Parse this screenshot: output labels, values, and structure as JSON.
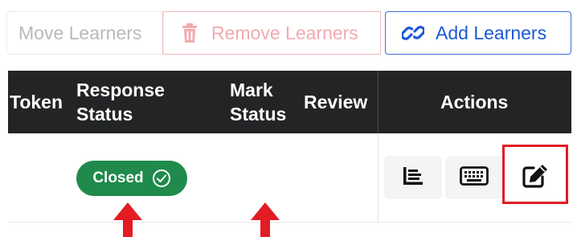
{
  "toolbar": {
    "move_label": "Move Learners",
    "remove_label": "Remove Learners",
    "add_label": "Add Learners"
  },
  "table": {
    "headers": {
      "token": "Token",
      "response_status_line1": "Response",
      "response_status_line2": "Status",
      "mark_status_line1": "Mark",
      "mark_status_line2": "Status",
      "review": "Review",
      "actions": "Actions"
    },
    "rows": [
      {
        "response_status": "Closed"
      }
    ]
  },
  "icons": {
    "remove": "trash-icon",
    "add": "link-icon",
    "badge": "check-circle-icon",
    "action_1": "chart-lines-icon",
    "action_2": "keyboard-icon",
    "action_3": "edit-icon",
    "annotation": "red-arrow-icon"
  },
  "colors": {
    "header_bg": "#222426",
    "badge_bg": "#1f8a4c",
    "add_blue": "#1d58d6",
    "remove_pink": "#f2aab0",
    "highlight_red": "#e31b23"
  }
}
